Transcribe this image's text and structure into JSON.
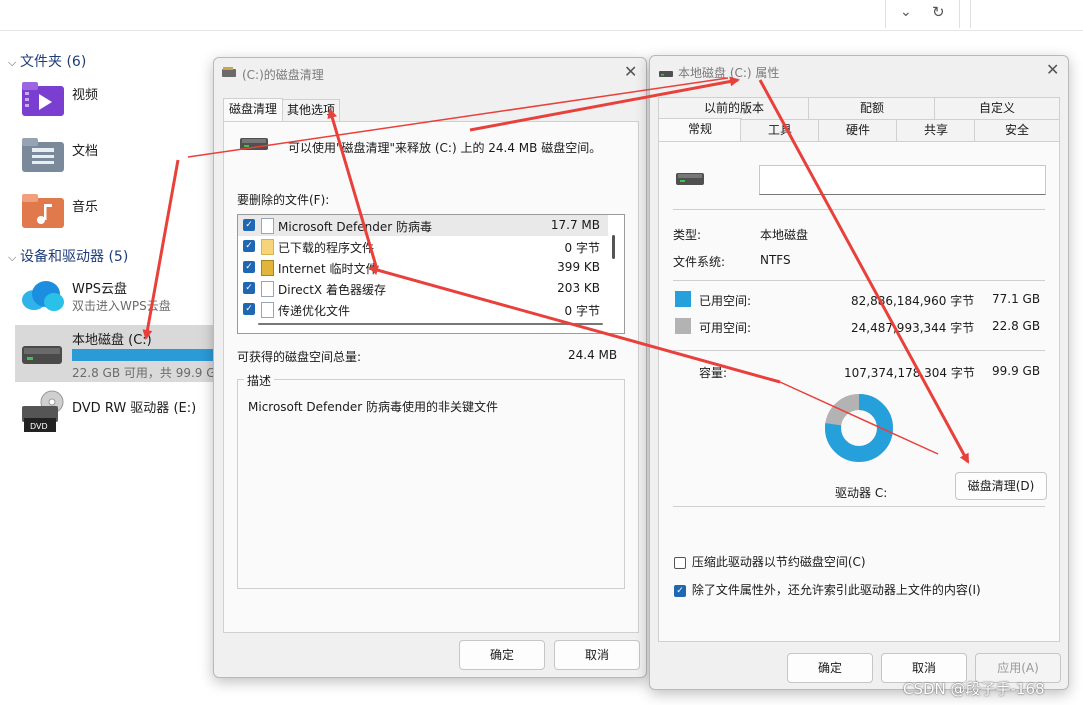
{
  "explorer": {
    "folders_header": "文件夹 (6)",
    "folders": [
      {
        "label": "视频",
        "icon": "video-folder-icon"
      },
      {
        "label": "文档",
        "icon": "documents-folder-icon"
      },
      {
        "label": "音乐",
        "icon": "music-folder-icon"
      }
    ],
    "drives_header": "设备和驱动器 (5)",
    "wps": {
      "name": "WPS云盘",
      "sub": "双击进入WPS云盘"
    },
    "local_disk": {
      "name": "本地磁盘 (C:)",
      "sub": "22.8 GB 可用，共 99.9 GB",
      "used_fraction": 0.772
    },
    "dvd": {
      "name": "DVD RW 驱动器 (E:)",
      "badge": "DVD"
    }
  },
  "cleanup": {
    "title": "(C:)的磁盘清理",
    "tabs": [
      "磁盘清理",
      "其他选项"
    ],
    "intro": "可以使用\"磁盘清理\"来释放  (C:) 上的 24.4 MB 磁盘空间。",
    "files_label": "要删除的文件(F):",
    "files": [
      {
        "name": "Microsoft Defender 防病毒",
        "size": "17.7 MB",
        "checked": true
      },
      {
        "name": "已下载的程序文件",
        "size": "0 字节",
        "checked": true
      },
      {
        "name": "Internet 临时文件",
        "size": "399 KB",
        "checked": true
      },
      {
        "name": "DirectX 着色器缓存",
        "size": "203 KB",
        "checked": true
      },
      {
        "name": "传递优化文件",
        "size": "0 字节",
        "checked": true
      }
    ],
    "total_label": "可获得的磁盘空间总量:",
    "total_value": "24.4 MB",
    "desc_legend": "描述",
    "desc_text": "Microsoft Defender 防病毒使用的非关键文件",
    "ok": "确定",
    "cancel": "取消"
  },
  "props": {
    "title": "本地磁盘 (C:) 属性",
    "tabs_top": [
      "以前的版本",
      "配额",
      "自定义"
    ],
    "tabs_bottom": [
      "常规",
      "工具",
      "硬件",
      "共享",
      "安全"
    ],
    "name_value": "",
    "type_label": "类型:",
    "type_value": "本地磁盘",
    "fs_label": "文件系统:",
    "fs_value": "NTFS",
    "used_label": "已用空间:",
    "used_bytes": "82,886,184,960 字节",
    "used_gb": "77.1 GB",
    "free_label": "可用空间:",
    "free_bytes": "24,487,993,344 字节",
    "free_gb": "22.8 GB",
    "cap_label": "容量:",
    "cap_bytes": "107,374,178,304 字节",
    "cap_gb": "99.9 GB",
    "drive_label": "驱动器 C:",
    "cleanup_btn": "磁盘清理(D)",
    "compress_label": "压缩此驱动器以节约磁盘空间(C)",
    "index_label": "除了文件属性外，还允许索引此驱动器上文件的内容(I)",
    "ok": "确定",
    "cancel": "取消",
    "apply": "应用(A)",
    "used_color": "#26a0da",
    "free_color": "#b3b3b3",
    "used_fraction": 0.772
  },
  "watermark": "CSDN @段子手-168"
}
